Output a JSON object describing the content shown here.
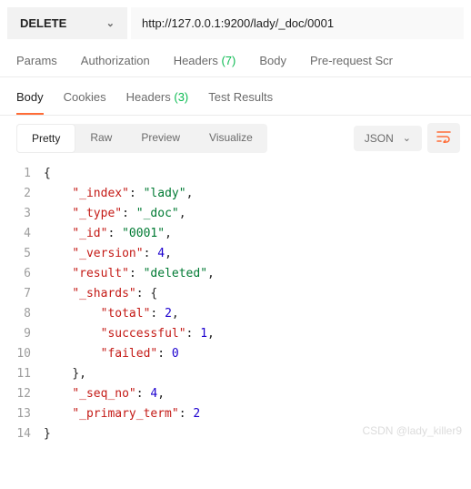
{
  "request": {
    "method": "DELETE",
    "url": "http://127.0.0.1:9200/lady/_doc/0001"
  },
  "reqTabs": {
    "params": "Params",
    "auth": "Authorization",
    "headers": "Headers",
    "headersCount": "(7)",
    "body": "Body",
    "prereq": "Pre-request Scr"
  },
  "respTabs": {
    "body": "Body",
    "cookies": "Cookies",
    "headers": "Headers",
    "headersCount": "(3)",
    "tests": "Test Results"
  },
  "viewTabs": {
    "pretty": "Pretty",
    "raw": "Raw",
    "preview": "Preview",
    "visualize": "Visualize",
    "format": "JSON"
  },
  "json": {
    "_index": "lady",
    "_type": "_doc",
    "_id": "0001",
    "_version": 4,
    "result": "deleted",
    "_shards": {
      "total": 2,
      "successful": 1,
      "failed": 0
    },
    "_seq_no": 4,
    "_primary_term": 2
  },
  "lineNumbers": [
    "1",
    "2",
    "3",
    "4",
    "5",
    "6",
    "7",
    "8",
    "9",
    "10",
    "11",
    "12",
    "13",
    "14"
  ],
  "watermark": "CSDN @lady_killer9"
}
